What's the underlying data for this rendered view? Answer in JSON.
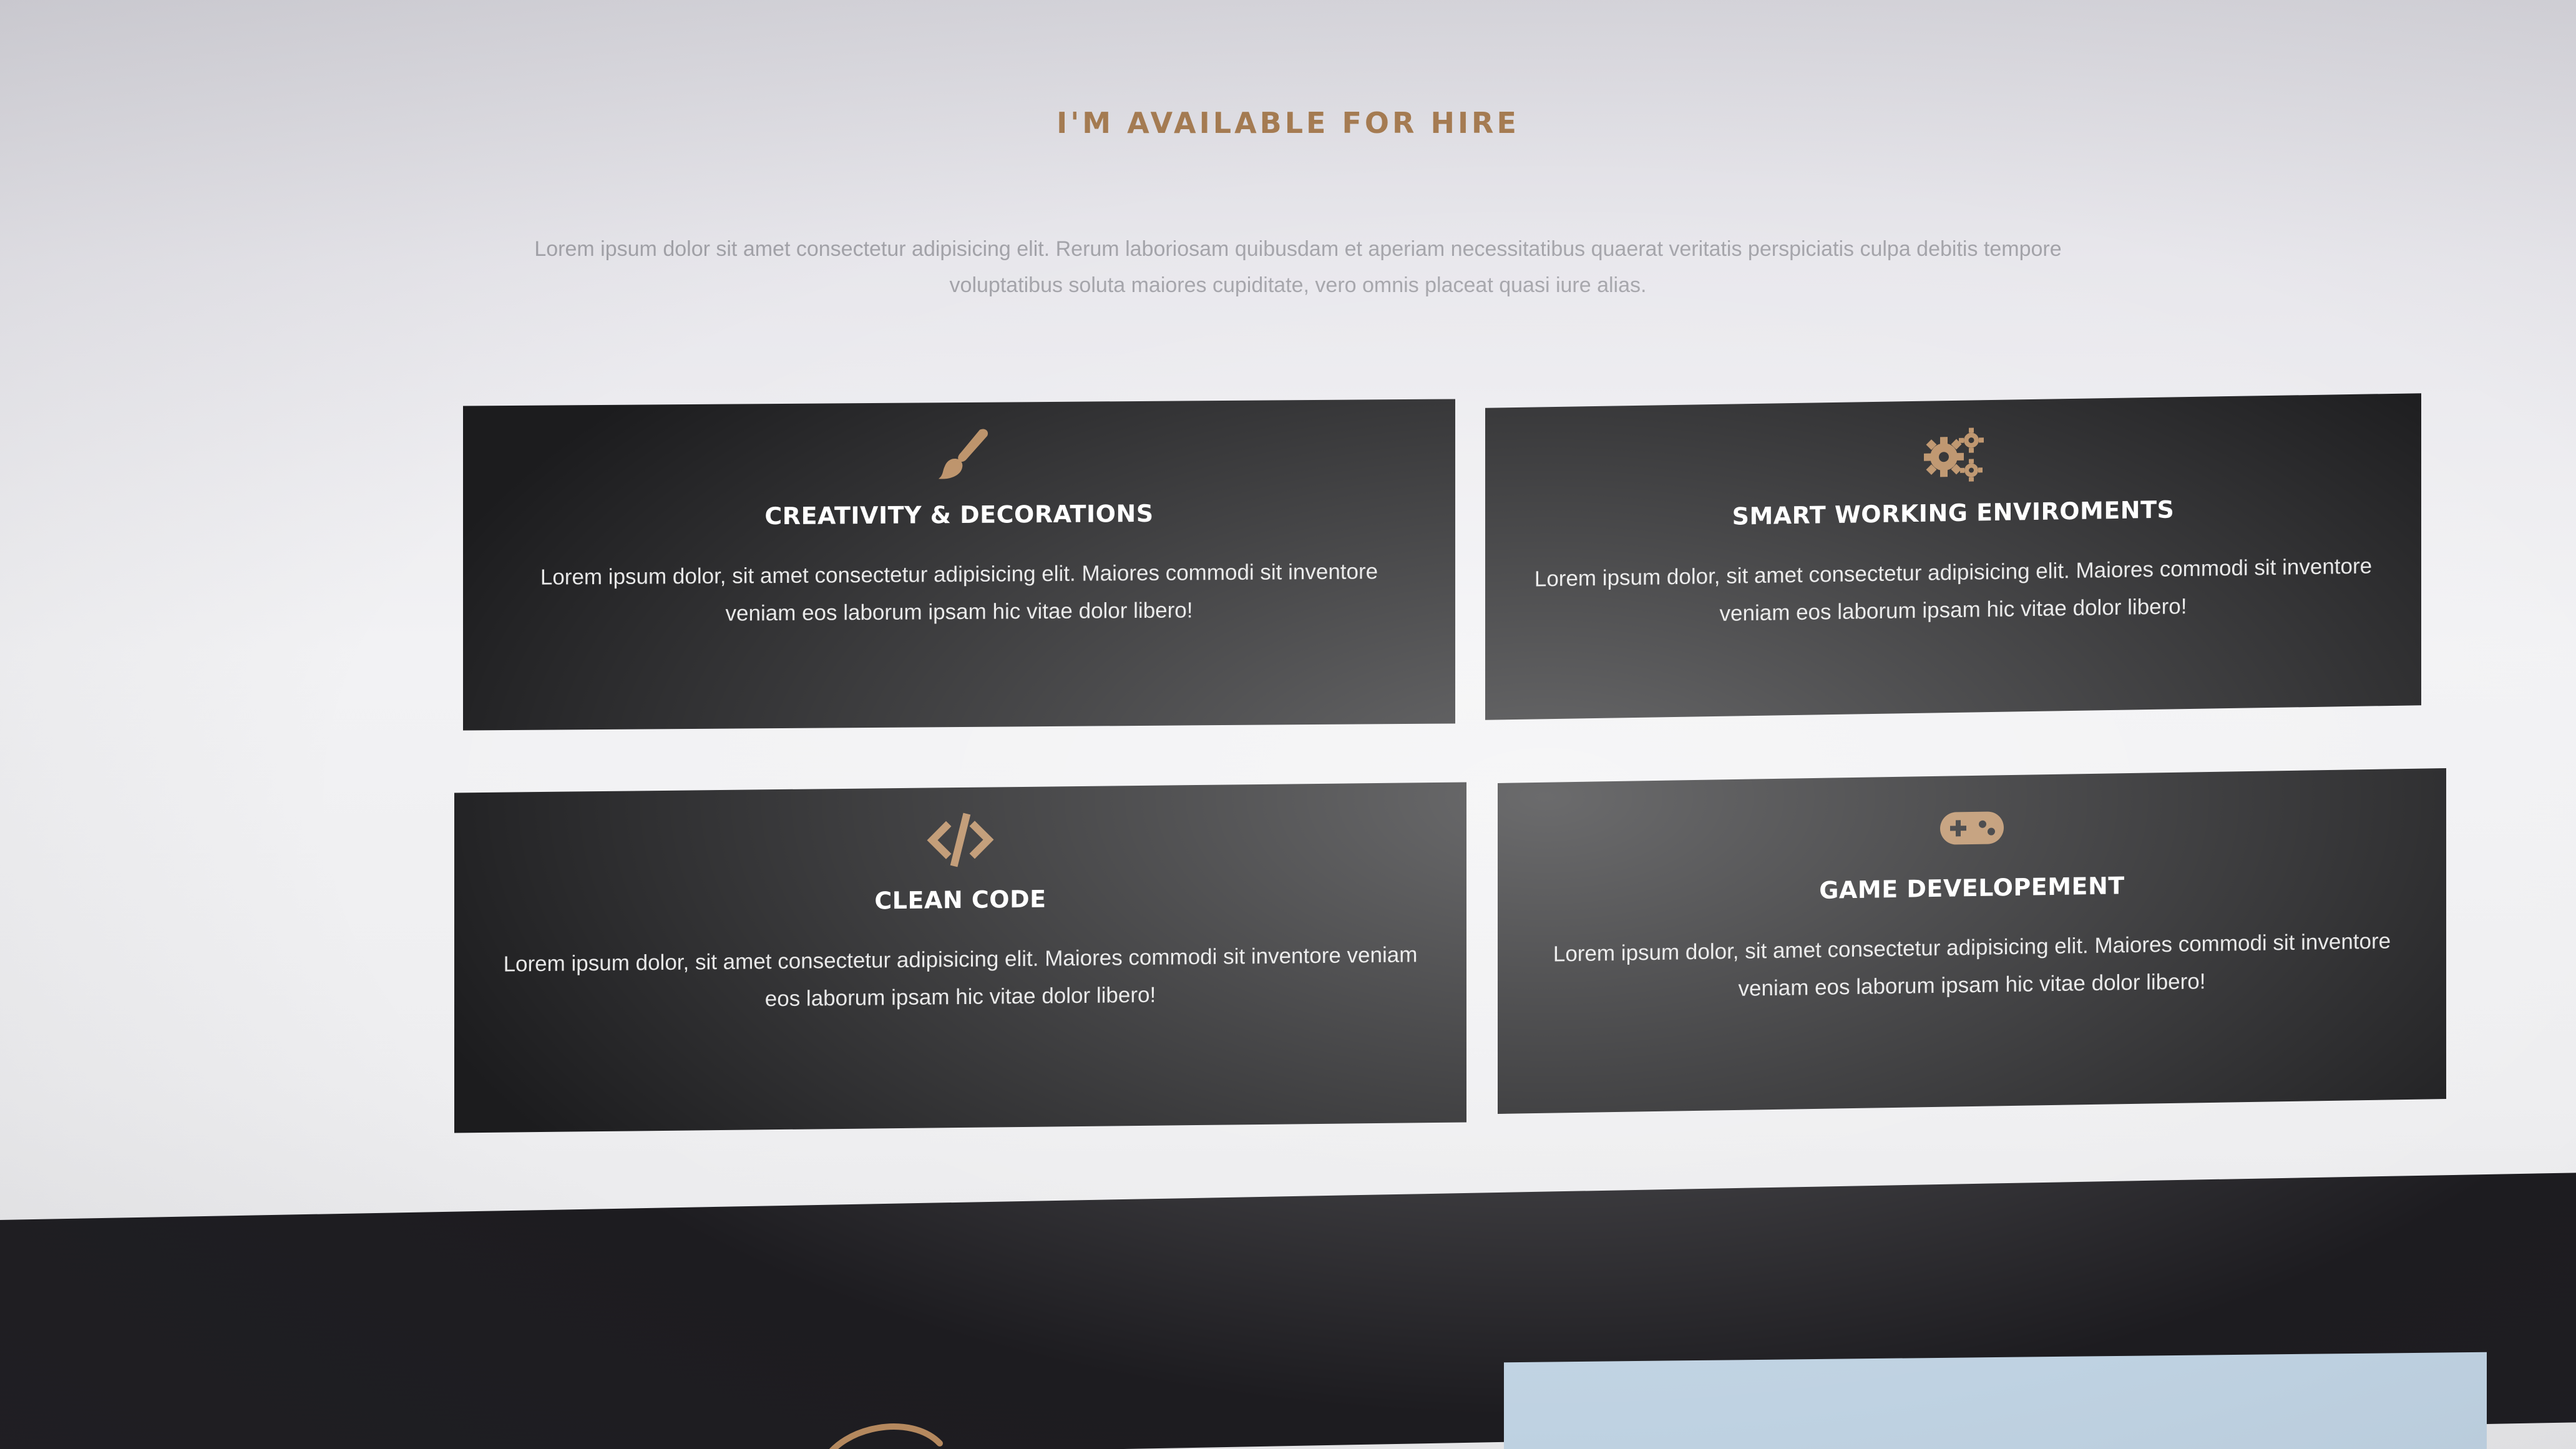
{
  "section": {
    "title": "I'M AVAILABLE FOR HIRE",
    "intro": "Lorem ipsum dolor sit amet consectetur adipisicing elit. Rerum laboriosam quibusdam et aperiam necessitatibus quaerat veritatis perspiciatis culpa debitis tempore voluptatibus soluta maiores cupiditate, vero omnis placeat quasi iure alias."
  },
  "colors": {
    "accent": "#a67c52",
    "card_background": "#1c1c1e",
    "footer_background": "#1d1c20",
    "footer_panel": "#bfd2e2"
  },
  "cards": [
    {
      "icon": "paintbrush-icon",
      "title": "CREATIVITY & DECORATIONS",
      "text": "Lorem ipsum dolor, sit amet consectetur adipisicing elit. Maiores commodi sit inventore veniam eos laborum ipsam hic vitae dolor libero!"
    },
    {
      "icon": "gears-icon",
      "title": "SMART WORKING ENVIROMENTS",
      "text": "Lorem ipsum dolor, sit amet consectetur adipisicing elit. Maiores commodi sit inventore veniam eos laborum ipsam hic vitae dolor libero!"
    },
    {
      "icon": "code-icon",
      "title": "CLEAN CODE",
      "text": "Lorem ipsum dolor, sit amet consectetur adipisicing elit. Maiores commodi sit inventore veniam eos laborum ipsam hic vitae dolor libero!"
    },
    {
      "icon": "gamepad-icon",
      "title": "GAME DEVELOPEMENT",
      "text": "Lorem ipsum dolor, sit amet consectetur adipisicing elit. Maiores commodi sit inventore veniam eos laborum ipsam hic vitae dolor libero!"
    }
  ]
}
